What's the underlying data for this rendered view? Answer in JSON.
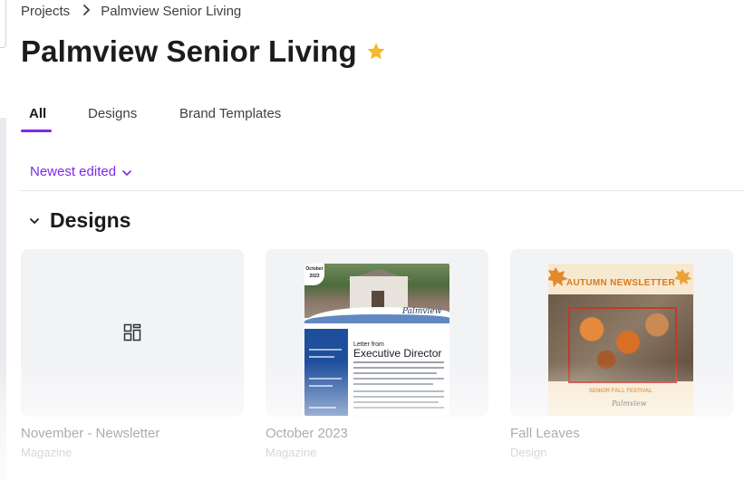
{
  "breadcrumb": {
    "root": "Projects",
    "current": "Palmview Senior Living"
  },
  "page": {
    "title": "Palmview Senior Living",
    "starred": true
  },
  "tabs": [
    {
      "label": "All",
      "active": true
    },
    {
      "label": "Designs",
      "active": false
    },
    {
      "label": "Brand Templates",
      "active": false
    }
  ],
  "sort": {
    "label": "Newest edited"
  },
  "section": {
    "title": "Designs",
    "expanded": true
  },
  "cards": [
    {
      "title": "November - Newsletter",
      "type": "Magazine",
      "thumbnail_icon": "layout-grid-icon"
    },
    {
      "title": "October 2023",
      "type": "Magazine",
      "thumb": {
        "month": "October",
        "year": "2023",
        "letter_small": "Letter from",
        "letter_big": "Executive Director",
        "script": "Palmview"
      }
    },
    {
      "title": "Fall Leaves",
      "type": "Design",
      "thumb": {
        "heading": "AUTUMN NEWSLETTER",
        "festival": "SENIOR FALL FESTIVAL",
        "script": "Palmview"
      }
    }
  ],
  "colors": {
    "accent": "#7d2ae8",
    "star": "#f5b82e",
    "text": "#1b1c1e",
    "muted": "#6b7079",
    "card_bg": "#f2f3f5"
  }
}
